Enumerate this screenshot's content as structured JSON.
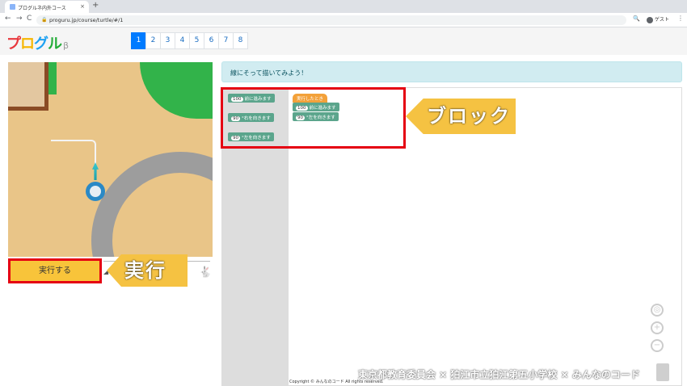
{
  "browser": {
    "tab_title": "プログルネ内外コース",
    "tab_close": "×",
    "new_tab": "+",
    "back": "←",
    "forward": "→",
    "reload": "C",
    "url": "proguru.jp/course/turtle/#/1",
    "lock": "🔒",
    "zoom": "🔍",
    "profile_label": "ゲスト",
    "menu": "⋮"
  },
  "header": {
    "logo_parts": [
      "プ",
      "ロ",
      "グ",
      "ル"
    ],
    "logo_beta": "β",
    "pages": [
      "1",
      "2",
      "3",
      "4",
      "5",
      "6",
      "7",
      "8"
    ],
    "active_page": "1"
  },
  "stage": {
    "run_label": "実行する",
    "slow_icon": "turtle-icon",
    "fast_icon": "rabbit-icon"
  },
  "instruction": "線にそって描いてみよう！",
  "toolbox": {
    "blocks": [
      {
        "num": "100",
        "text": "前に進みます"
      },
      {
        "num": "90",
        "text": "°右を向きます"
      },
      {
        "num": "90",
        "text": "°左を向きます"
      }
    ]
  },
  "program": {
    "event": "実行したとき",
    "blocks": [
      {
        "num": "100",
        "text": "前に進みます"
      },
      {
        "num": "90",
        "text": "°左を向きます"
      }
    ]
  },
  "annotations": {
    "block_callout": "ブロック",
    "run_callout": "実行"
  },
  "footer": {
    "copyright": "Copyright © みんなのコード All rights reserved.",
    "watermark": "東京都教育委員会 × 狛江市立狛江第五小学校 × みんなのコード"
  }
}
